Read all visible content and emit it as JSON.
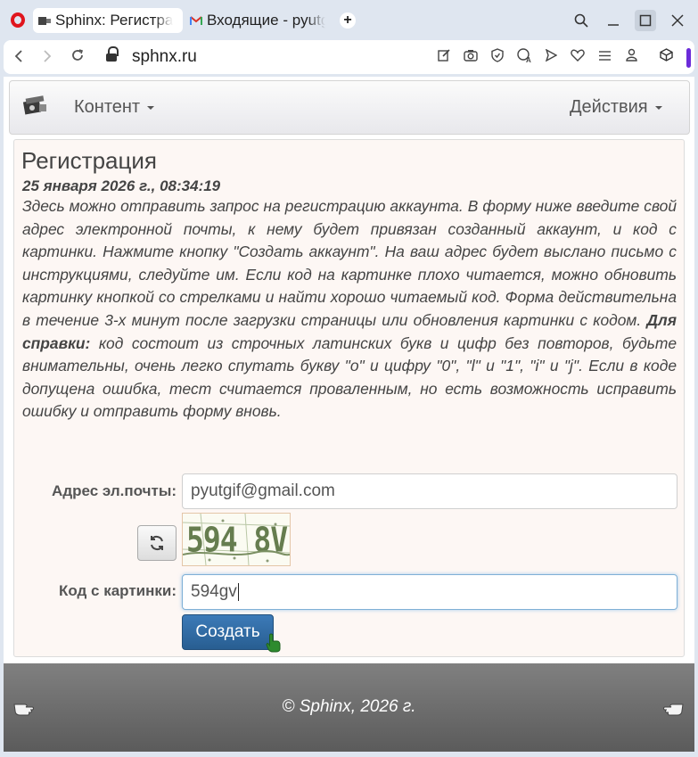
{
  "browser": {
    "tabs": [
      {
        "title": "Sphinx: Регистра",
        "active": true
      },
      {
        "title": "Входящие - pyutg",
        "active": false
      }
    ],
    "url": "sphnx.ru",
    "icons": [
      "opera-logo-icon",
      "back-icon",
      "forward-icon",
      "reload-icon",
      "lock-icon",
      "edit-icon",
      "camera-icon",
      "shield-icon",
      "translate-icon",
      "send-icon",
      "heart-icon",
      "menu-icon",
      "profile-icon",
      "cube-icon"
    ]
  },
  "navbar": {
    "menu_content": "Контент",
    "menu_actions": "Действия"
  },
  "page": {
    "title": "Регистрация",
    "date": "25 января 2026 г., 08:34:19",
    "description_part1": "Здесь можно отправить запрос на регистрацию аккаунта. В форму ниже введите свой адрес электронной почты, к нему будет привязан созданный аккаунт, и код с картинки. Нажмите кнопку \"Создать аккаунт\". На ваш адрес будет выслано письмо с инструкциями, следуйте им. Если код на картинке плохо читается, можно обновить картинку кнопкой со стрелками и найти хорошо читаемый код. Форма действительна в течение 3-х минут после загрузки страницы или обновления картинки с кодом.",
    "description_bold": "Для справки:",
    "description_part2": "код состоит из строчных латинских букв и цифр без повторов, будьте внимательны, очень легко спутать букву \"o\" и цифру \"0\", \"l\" и \"1\", \"i\" и \"j\". Если в коде допущена ошибка, тест считается проваленным, но есть возможность исправить ошибку и отправить форму вновь."
  },
  "form": {
    "email_label": "Адрес эл.почты:",
    "email_value": "pyutgif@gmail.com",
    "captcha_text": "594 8V",
    "code_label": "Код с картинки:",
    "code_value": "594gv",
    "submit_label": "Создать"
  },
  "footer": {
    "text": "© Sphinx, 2026 г."
  }
}
